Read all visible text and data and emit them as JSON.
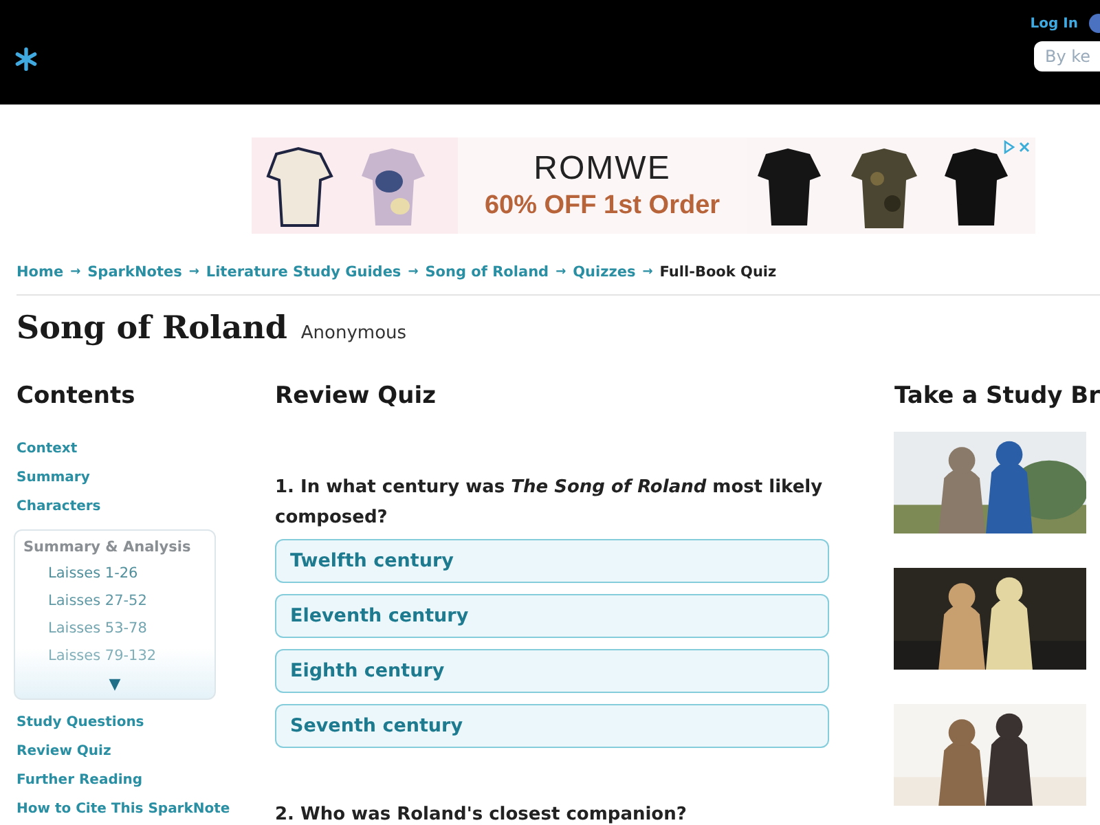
{
  "header": {
    "login": "Log In",
    "search": {
      "placeholder": "By ke"
    }
  },
  "ad": {
    "brand": "ROMWE",
    "offer": "60% OFF 1st Order"
  },
  "breadcrumb": [
    {
      "label": "Home",
      "current": false
    },
    {
      "label": "SparkNotes",
      "current": false
    },
    {
      "label": "Literature Study Guides",
      "current": false
    },
    {
      "label": "Song of Roland",
      "current": false
    },
    {
      "label": "Quizzes",
      "current": false
    },
    {
      "label": "Full-Book Quiz",
      "current": true
    }
  ],
  "separator": "→",
  "title": "Song of Roland",
  "author": "Anonymous",
  "contents": {
    "heading": "Contents",
    "links_top": [
      "Context",
      "Summary",
      "Characters"
    ],
    "section": {
      "label": "Summary & Analysis",
      "items": [
        "Laisses 1-26",
        "Laisses 27-52",
        "Laisses 53-78",
        "Laisses 79-132"
      ],
      "toggle": "▼"
    },
    "links_bottom": [
      "Study Questions",
      "Review Quiz",
      "Further Reading",
      "How to Cite This SparkNote"
    ]
  },
  "quiz": {
    "heading": "Review Quiz",
    "questions": [
      {
        "text": "1. In what century was *The Song of Roland* most likely composed?",
        "answers": [
          "Twelfth century",
          "Eleventh century",
          "Eighth century",
          "Seventh century"
        ]
      },
      {
        "text": "2. Who was Roland's closest companion?"
      }
    ]
  },
  "aside": {
    "heading": "Take a Study Br"
  }
}
